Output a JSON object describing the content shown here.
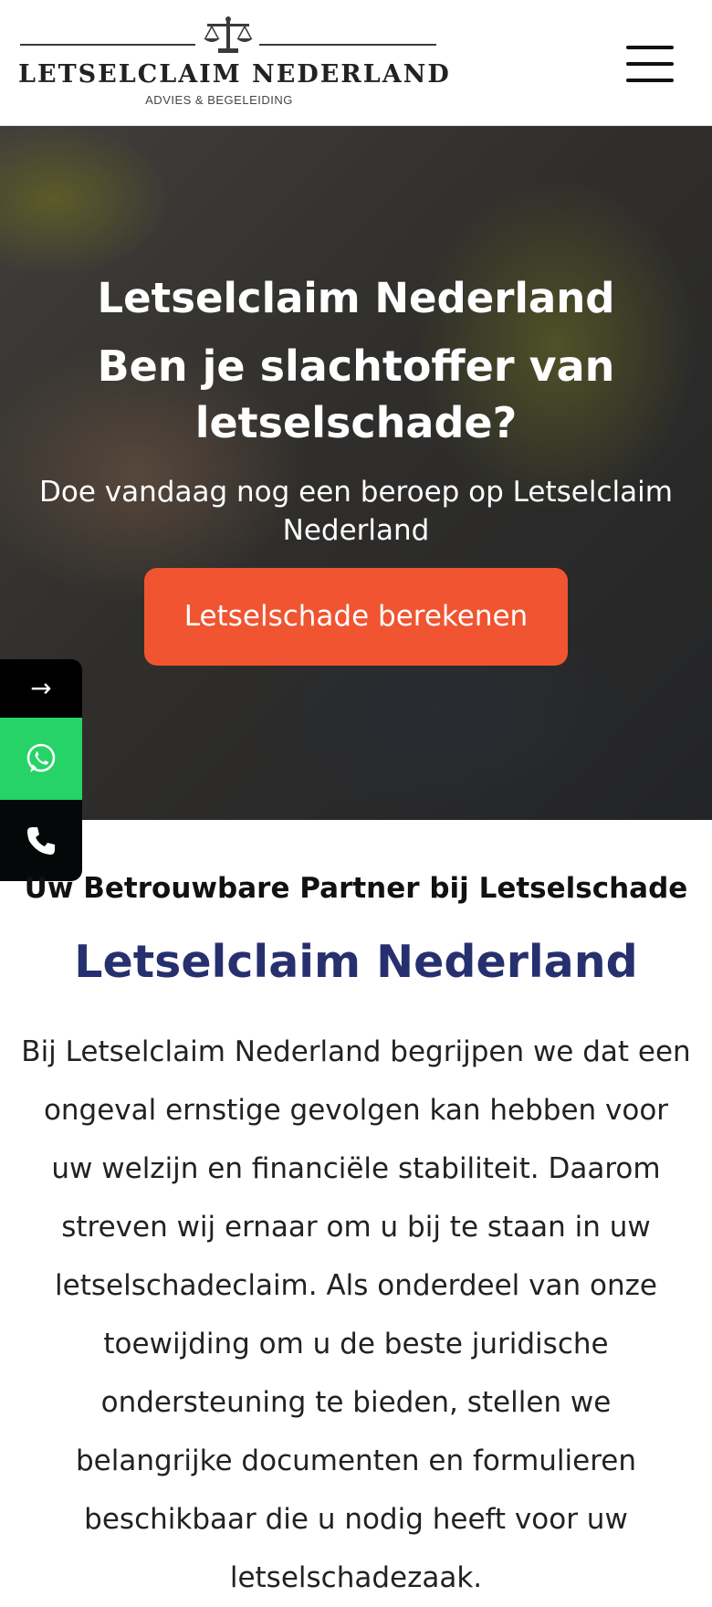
{
  "header": {
    "logo": {
      "brand": "LETSELCLAIM NEDERLAND",
      "tagline": "ADVIES & BEGELEIDING",
      "icon": "scales-of-justice-icon"
    },
    "menu_icon": "hamburger-menu-icon"
  },
  "hero": {
    "title": "Letselclaim Nederland",
    "subtitle": "Ben je slachtoffer van letselschade?",
    "text": "Doe vandaag nog een beroep op Letselclaim Nederland",
    "cta_label": "Letselschade berekenen",
    "cta_color": "#f05431"
  },
  "floating_bar": {
    "arrow": "→",
    "whatsapp_icon": "whatsapp-icon",
    "whatsapp_color": "#25d366",
    "phone_icon": "phone-icon"
  },
  "content": {
    "kicker": "Uw Betrouwbare Partner bij Letselschade",
    "title": "Letselclaim Nederland",
    "title_color": "#27306e",
    "paragraph": "Bij Letselclaim Nederland begrijpen we dat een ongeval ernstige gevolgen kan hebben voor uw welzijn en financiële stabiliteit. Daarom streven wij ernaar om u bij te staan in uw letselschadeclaim. Als onderdeel van onze toewijding om u de beste juridische ondersteuning te bieden, stellen we belangrijke documenten en formulieren beschikbaar die u nodig heeft voor uw letselschadezaak."
  }
}
